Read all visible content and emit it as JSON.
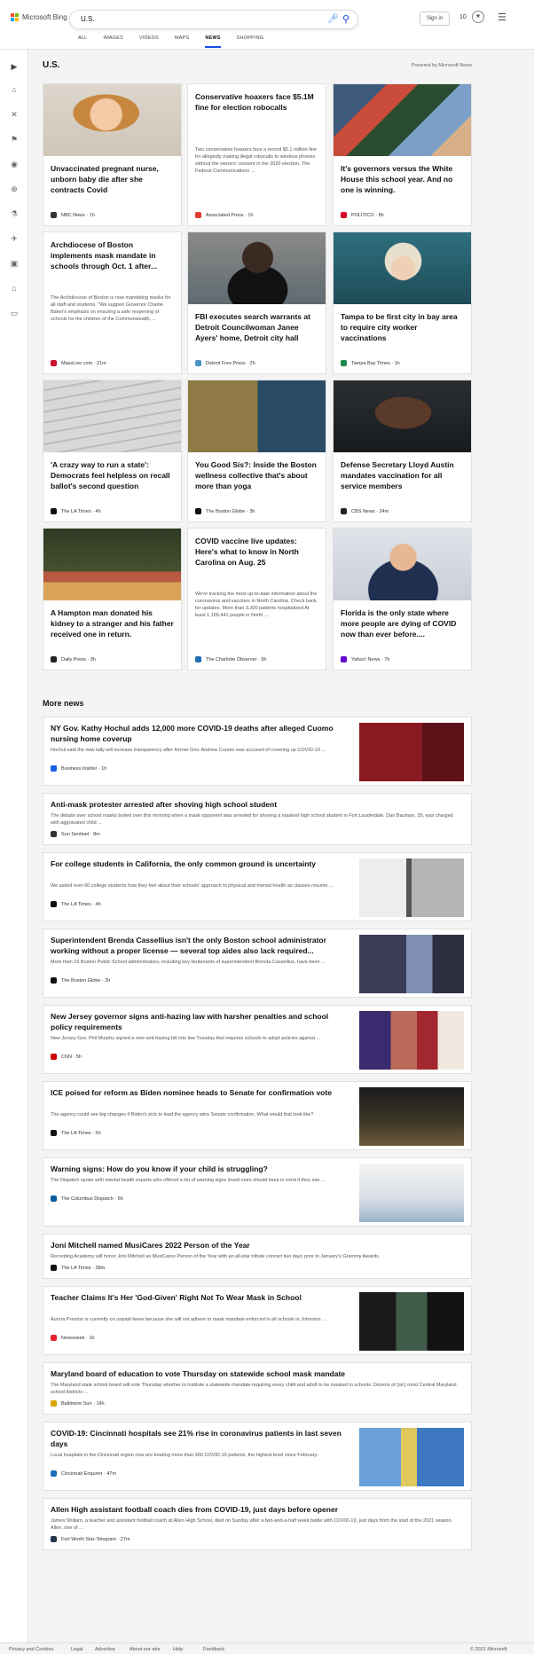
{
  "header": {
    "brand": "Microsoft Bing",
    "search_value": "U.S.",
    "signin_label": "Sign in",
    "points": "10",
    "colors": {
      "accent": "#174ae4"
    }
  },
  "tabs": [
    "ALL",
    "IMAGES",
    "VIDEOS",
    "MAPS",
    "NEWS",
    "SHOPPING"
  ],
  "active_tab": "NEWS",
  "rail_icons": [
    "expand-icon",
    "home-icon",
    "sports-icon",
    "flag-icon",
    "location-icon",
    "globe-icon",
    "science-icon",
    "technology-icon",
    "entertainment-icon",
    "politics-icon",
    "money-icon"
  ],
  "section": {
    "title": "U.S.",
    "powered": "Powered by Microsoft News"
  },
  "cards": [
    {
      "title": "Unvaccinated pregnant nurse, unborn baby die after she contracts Covid",
      "provider": "NBC News",
      "time": "1h",
      "logo_color": "#333",
      "image": "portrait"
    },
    {
      "title": "Conservative hoaxers face $5.1M fine for election robocalls",
      "snippet": "Two conservative hoaxers face a record $5.1 million fine for allegedly making illegal robocalls to wireless phones without the owners' consent in the 2020 election. The Federal Communications ...",
      "provider": "Associated Press",
      "time": "1h",
      "logo_color": "#e23b2e"
    },
    {
      "title": "It's governors versus the White House this school year. And no one is winning.",
      "provider": "POLITICO",
      "time": "8h",
      "logo_color": "#d4002b",
      "image": "classroom"
    },
    {
      "title": "Archdiocese of Boston implements mask mandate in schools through Oct. 1 after...",
      "snippet": "The Archdiocese of Boston is now mandating masks for all staff and students. \"We support Governor Charlie Baker's emphasis on ensuring a safe reopening of schools for the children of the Commonwealth, ...",
      "provider": "MassLive.com",
      "time": "21m",
      "logo_color": "#c8102e"
    },
    {
      "title": "FBI executes search warrants at Detroit Councilwoman Janee Ayers' home, Detroit city hall",
      "provider": "Detroit Free Press",
      "time": "2h",
      "logo_color": "#4a90c2",
      "image": "speaker"
    },
    {
      "title": "Tampa to be first city in bay area to require city worker vaccinations",
      "provider": "Tampa Bay Times",
      "time": "1h",
      "logo_color": "#1c8a4a",
      "image": "mayor"
    },
    {
      "title": "'A crazy way to run a state': Democrats feel helpless on recall ballot's second question",
      "provider": "The LA Times",
      "time": "4h",
      "logo_color": "#111",
      "image": "ballot"
    },
    {
      "title": "You Good Sis?: Inside the Boston wellness collective that's about more than yoga",
      "provider": "The Boston Globe",
      "time": "3h",
      "logo_color": "#111",
      "image": "women"
    },
    {
      "title": "Defense Secretary Lloyd Austin mandates vaccination for all service members",
      "provider": "CBS News",
      "time": "24m",
      "logo_color": "#222",
      "image": "austin"
    },
    {
      "title": "A Hampton man donated his kidney to a stranger and his father received one in return.",
      "provider": "Daily Press",
      "time": "3h",
      "logo_color": "#222",
      "image": "men"
    },
    {
      "title": "COVID vaccine live updates: Here's what to know in North Carolina on Aug. 25",
      "snippet": "We're tracking the most up-to-date information about the coronavirus and vaccines in North Carolina. Check back for updates. More than 3,300 patients hospitalized At least 1,166,441 people in North ...",
      "provider": "The Charlotte Observer",
      "time": "5h",
      "logo_color": "#1f6fb2"
    },
    {
      "title": "Florida is the only state where more people are dying of COVID now than ever before....",
      "provider": "Yahoo! News",
      "time": "7h",
      "logo_color": "#6001d2",
      "image": "desantis"
    }
  ],
  "more_title": "More news",
  "more": [
    {
      "title": "NY Gov. Kathy Hochul adds 12,000 more COVID-19 deaths after alleged Cuomo nursing home coverup",
      "snippet": "Hochul said the new tally will increase transparency after former Gov. Andrew Cuomo was accused of covering up COVID-19 ...",
      "provider": "Business Insider",
      "time": "1h",
      "logo_color": "#1b5ce6",
      "image": "hochul"
    },
    {
      "title": "Anti-mask protester arrested after shoving high school student",
      "snippet": "The debate over school masks boiled over this morning when a mask opponent was arrested for shoving a masked high school student in Fort Lauderdale. Dan Bauman, 39, was charged with aggravated child ...",
      "provider": "Sun Sentinel",
      "time": "8m",
      "logo_color": "#333"
    },
    {
      "title": "For college students in California, the only common ground is uncertainty",
      "snippet": "We asked over 60 college students how they feel about their schools' approach to physical and mental health as classes resume ...",
      "provider": "The LA Times",
      "time": "4h",
      "logo_color": "#111",
      "image": "students"
    },
    {
      "title": "Superintendent Brenda Cassellius isn't the only Boston school administrator working without a proper license — several top aides also lack required...",
      "snippet": "More than 15 Boston Public School administrators, including key lieutenants of superintendent Brenda Cassellius, have been ...",
      "provider": "The Boston Globe",
      "time": "2h",
      "logo_color": "#111",
      "image": "cassellius"
    },
    {
      "title": "New Jersey governor signs anti-hazing law with harsher penalties and school policy requirements",
      "snippet": "New Jersey Gov. Phil Murphy signed a new anti-hazing bill into law Tuesday that requires schools to adopt policies against ...",
      "provider": "CNN",
      "time": "5h",
      "logo_color": "#cc0000",
      "image": "murphy"
    },
    {
      "title": "ICE poised for reform as Biden nominee heads to Senate for confirmation vote",
      "snippet": "The agency could see big changes if Biden's pick to lead the agency wins Senate confirmation. What would that look like?",
      "provider": "The LA Times",
      "time": "5h",
      "logo_color": "#111",
      "image": "ice"
    },
    {
      "title": "Warning signs: How do you know if your child is struggling?",
      "snippet": "The Dispatch spoke with mental health experts who offered a list of warning signs loved ones should keep in mind if they see ...",
      "provider": "The Columbus Dispatch",
      "time": "6h",
      "logo_color": "#0a5c9e",
      "image": "room"
    },
    {
      "title": "Joni Mitchell named MusiCares 2022 Person of the Year",
      "snippet": "Recording Academy will honor Joni Mitchell as MusiCares Person of the Year with an all-star tribute concert two days prior to January's Grammy Awards.",
      "provider": "The LA Times",
      "time": "38m",
      "logo_color": "#111"
    },
    {
      "title": "Teacher Claims It's Her 'God-Given' Right Not To Wear Mask in School",
      "snippet": "Aurora Preston is currently on unpaid leave because she will not adhere to mask mandate enforced in all schools in Johnston ...",
      "provider": "Newsweek",
      "time": "1h",
      "logo_color": "#e5202e",
      "image": "teacher"
    },
    {
      "title": "Maryland board of education to vote Thursday on statewide school mask mandate",
      "snippet": "The Maryland state school board will vote Thursday whether to institute a statewide mandate requiring every child and adult to be masked in schools. Dozens of (sic) most Central Maryland school districts ...",
      "provider": "Baltimore Sun",
      "time": "14h",
      "logo_color": "#d9a400"
    },
    {
      "title": "COVID-19: Cincinnati hospitals see 21% rise in coronavirus patients in last seven days",
      "snippet": "Local hospitals in the Cincinnati region now are treating more than 360 COVID-19 patients, the highest level since February.",
      "provider": "Cincinnati Enquirer",
      "time": "47m",
      "logo_color": "#1a6fb8",
      "image": "hospital"
    },
    {
      "title": "Allen High assistant football coach dies from COVID-19, just days before opener",
      "snippet": "James Shillam, a teacher and assistant football coach at Allen High School, died on Sunday after a two-and-a-half week battle with COVID-19, just days from the start of the 2021 season. Allen, one of ...",
      "provider": "Fort Worth Star-Telegram",
      "time": "27m",
      "logo_color": "#23374d"
    }
  ],
  "footer": {
    "links": [
      "Privacy and Cookies",
      "Legal",
      "Advertise",
      "About our ads",
      "Help",
      "Feedback"
    ],
    "copyright": "© 2021 Microsoft"
  }
}
